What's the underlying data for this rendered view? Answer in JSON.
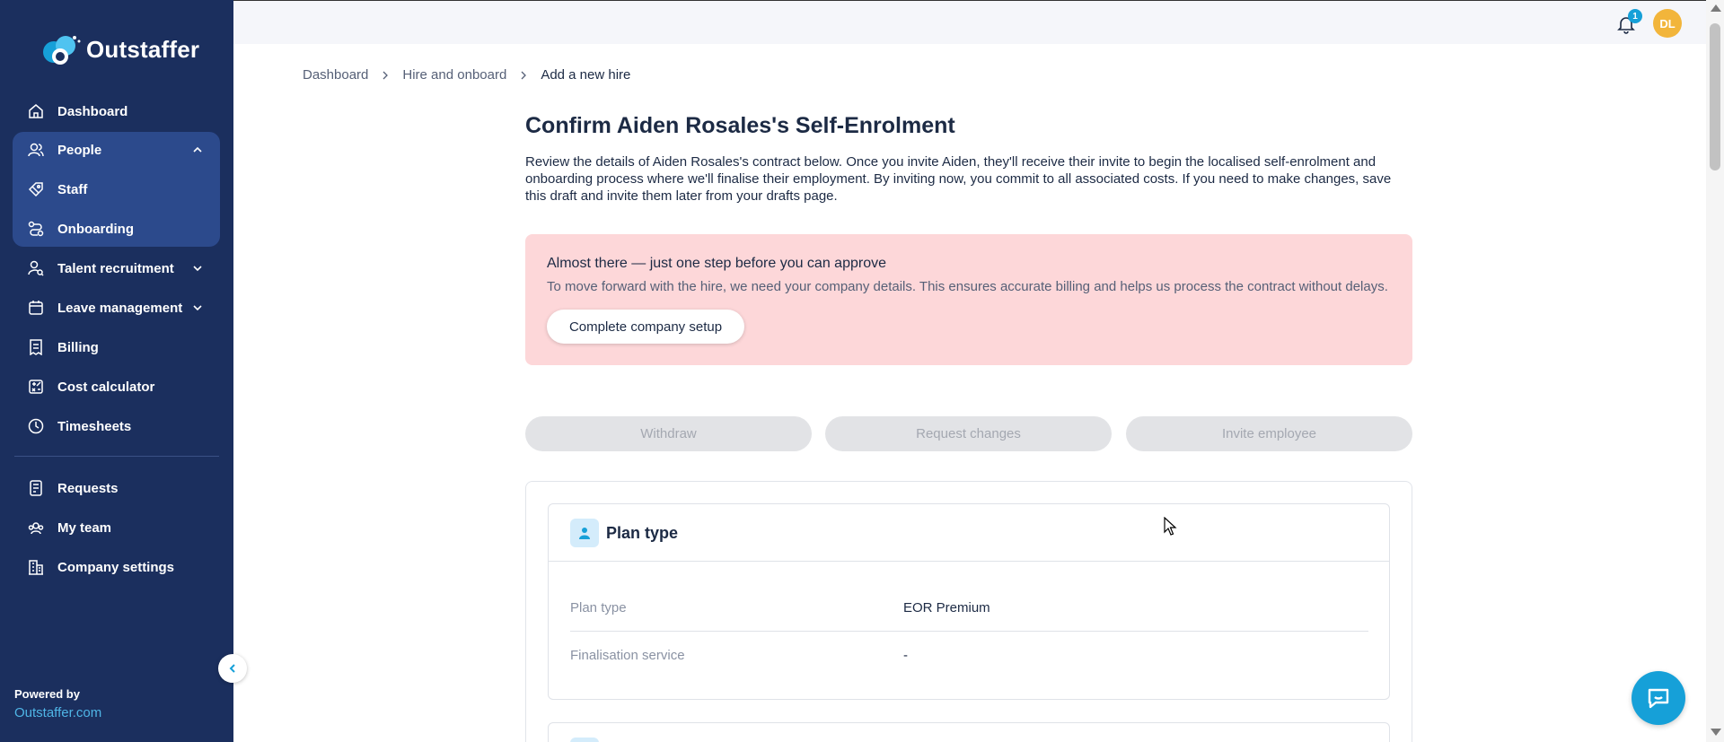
{
  "brand": {
    "name": "Outstaffer"
  },
  "sidebar": {
    "items": [
      {
        "label": "Dashboard",
        "icon": "home-icon"
      },
      {
        "label": "People",
        "icon": "people-icon",
        "expanded": true
      },
      {
        "label": "Staff",
        "icon": "tag-icon"
      },
      {
        "label": "Onboarding",
        "icon": "route-icon"
      },
      {
        "label": "Talent recruitment",
        "icon": "user-search-icon"
      },
      {
        "label": "Leave management",
        "icon": "calendar-icon"
      },
      {
        "label": "Billing",
        "icon": "receipt-icon"
      },
      {
        "label": "Cost calculator",
        "icon": "calculator-icon"
      },
      {
        "label": "Timesheets",
        "icon": "clock-icon"
      },
      {
        "label": "Requests",
        "icon": "document-icon"
      },
      {
        "label": "My team",
        "icon": "team-icon"
      },
      {
        "label": "Company settings",
        "icon": "building-icon"
      }
    ],
    "powered_by_label": "Powered by",
    "powered_by_link": "Outstaffer.com"
  },
  "topbar": {
    "notification_count": "1",
    "avatar_initials": "DL"
  },
  "breadcrumb": {
    "items": [
      "Dashboard",
      "Hire and onboard",
      "Add a new hire"
    ]
  },
  "page": {
    "title": "Confirm Aiden Rosales's Self-Enrolment",
    "intro": "Review the details of Aiden Rosales's contract below. Once you invite Aiden, they'll receive their invite to begin the localised self-enrolment and onboarding process where we'll finalise their employment. By inviting now, you commit to all associated costs. If you need to make changes, save this draft and invite them later from your drafts page."
  },
  "alert": {
    "title": "Almost there — just one step before you can approve",
    "body": "To move forward with the hire, we need your company details. This ensures accurate billing and helps us process the contract without delays.",
    "button": "Complete company setup"
  },
  "actions": {
    "withdraw": "Withdraw",
    "request_changes": "Request changes",
    "invite": "Invite employee"
  },
  "plan": {
    "title": "Plan type",
    "rows": [
      {
        "label": "Plan type",
        "value": "EOR Premium"
      },
      {
        "label": "Finalisation service",
        "value": "-"
      }
    ]
  },
  "colors": {
    "sidebar": "#1b2f5e",
    "sidebar_active": "#2c4a8c",
    "accent": "#16a0d8",
    "alert_bg": "#fdd7d9",
    "avatar": "#f2b53b"
  }
}
